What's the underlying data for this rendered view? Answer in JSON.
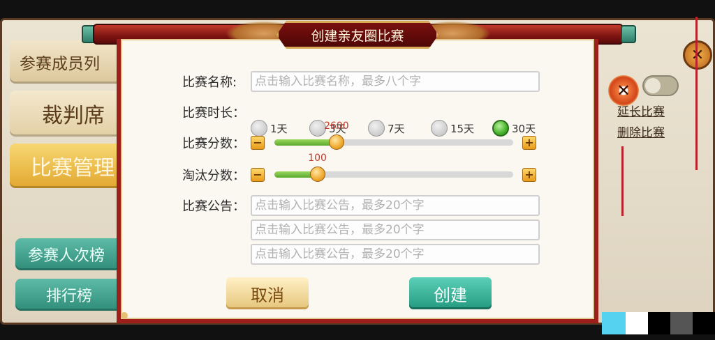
{
  "background": {
    "tabs": {
      "members": "参赛成员列",
      "referee": "裁判席",
      "manage": "比赛管理",
      "participation": "参赛人次榜",
      "ranking": "排行榜"
    },
    "links": {
      "extend": "延长比赛",
      "delete": "删除比赛"
    },
    "strip_colors": [
      "#55d2f0",
      "#ffffff",
      "#000000",
      "#555555",
      "#000000"
    ]
  },
  "dialog": {
    "title": "创建亲友圈比赛",
    "name": {
      "label": "比赛名称:",
      "value": "",
      "placeholder": "点击输入比赛名称，最多八个字"
    },
    "duration": {
      "label": "比赛时长：",
      "options": [
        "1天",
        "3天",
        "7天",
        "15天",
        "30天"
      ],
      "selected": "30天"
    },
    "score": {
      "label": "比赛分数：",
      "value": "2600",
      "fraction": 0.26
    },
    "elimination": {
      "label": "淘汰分数：",
      "value": "100",
      "fraction": 0.18
    },
    "announcement": {
      "label": "比赛公告：",
      "placeholders": [
        "点击输入比赛公告，最多20个字",
        "点击输入比赛公告，最多20个字",
        "点击输入比赛公告，最多20个字"
      ]
    },
    "buttons": {
      "cancel": "取消",
      "create": "创建"
    },
    "icons": {
      "minus": "−",
      "plus": "+",
      "close": "✕"
    }
  },
  "colors": {
    "frame_red": "#9c1f1c",
    "accent_green": "#45b22b",
    "teal": "#239a80",
    "gold": "#e89a1a"
  }
}
